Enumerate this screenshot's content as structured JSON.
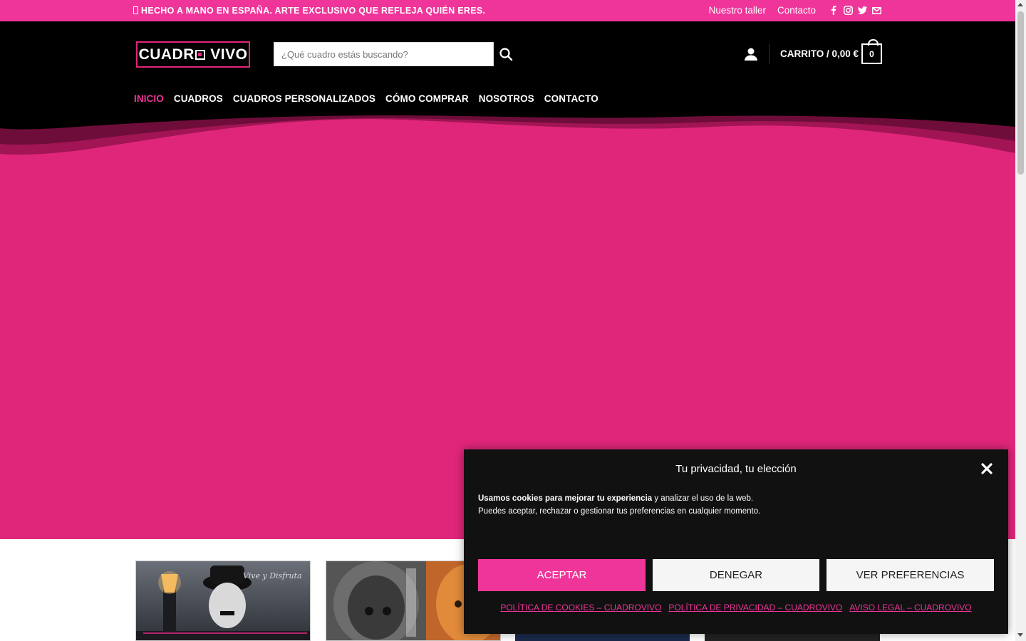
{
  "topbar": {
    "promo": "HECHO A MANO EN ESPAÑA. ARTE EXCLUSIVO QUE REFLEJA QUIÉN ERES.",
    "links": [
      "Nuestro taller",
      "Contacto"
    ],
    "social": [
      "facebook-icon",
      "instagram-icon",
      "twitter-icon",
      "email-icon"
    ]
  },
  "header": {
    "logo_text": "CUADRO VIVO",
    "search_placeholder": "¿Qué cuadro estás buscando?",
    "cart_label": "CARRITO / 0,00 €",
    "cart_count": "0"
  },
  "nav": {
    "items": [
      "INICIO",
      "CUADROS",
      "CUADROS PERSONALIZADOS",
      "CÓMO COMPRAR",
      "NOSOTROS",
      "CONTACTO"
    ],
    "active": "INICIO"
  },
  "cookie": {
    "title": "Tu privacidad, tu elección",
    "message_bold": "Usamos cookies para mejorar tu experiencia",
    "message_rest": " y analizar el uso de la web.",
    "message_line2": "Puedes aceptar, rechazar o gestionar tus preferencias en cualquier momento.",
    "accept": "ACEPTAR",
    "deny": "DENEGAR",
    "prefs": "VER PREFERENCIAS",
    "links": [
      "POLÍTICA DE COOKIES – CUADROVIVO",
      "POLÍTICA DE PRIVACIDAD – CUADROVIVO",
      "AVISO LEGAL – CUADROVIVO"
    ]
  },
  "products": {
    "thumb1_caption": "Vive y Disfruta"
  },
  "colors": {
    "brand_pink": "#f0359a",
    "hero_pink": "#e0267a",
    "header_black": "#000000"
  }
}
